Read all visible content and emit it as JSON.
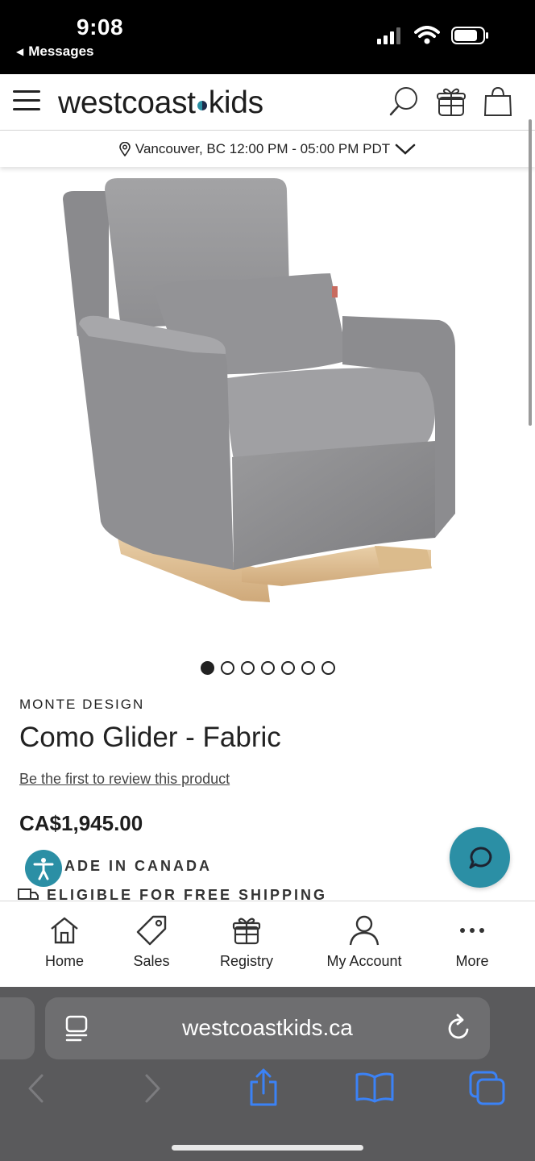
{
  "status_bar": {
    "time": "9:08",
    "back_label": "Messages"
  },
  "header": {
    "logo_left": "westcoast",
    "logo_right": "kids"
  },
  "location": {
    "text": "Vancouver, BC 12:00 PM - 05:00 PM PDT"
  },
  "carousel": {
    "total_images": 7,
    "active_index": 0
  },
  "product": {
    "brand": "MONTE DESIGN",
    "title": "Como Glider - Fabric",
    "review_link": "Be the first to review this product",
    "price": "CA$1,945.00",
    "feature_made": "ADE IN CANADA",
    "feature_shipping": "ELIGIBLE FOR FREE SHIPPING"
  },
  "bottom_nav": {
    "home": "Home",
    "sales": "Sales",
    "registry": "Registry",
    "account": "My Account",
    "more": "More"
  },
  "safari": {
    "url": "westcoastkids.ca"
  },
  "colors": {
    "accent": "#2b8fa5",
    "safari_bg": "#5a5a5c",
    "ios_blue": "#3b82f6"
  }
}
